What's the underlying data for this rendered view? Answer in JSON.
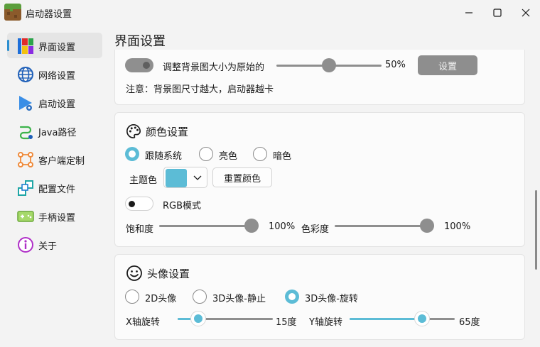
{
  "window": {
    "title": "启动器设置"
  },
  "sidebar": {
    "items": [
      {
        "label": "界面设置",
        "icon": "palette-grid-icon"
      },
      {
        "label": "网络设置",
        "icon": "globe-icon"
      },
      {
        "label": "启动设置",
        "icon": "play-icon"
      },
      {
        "label": "Java路径",
        "icon": "path-icon"
      },
      {
        "label": "客户端定制",
        "icon": "customize-icon"
      },
      {
        "label": "配置文件",
        "icon": "config-icon"
      },
      {
        "label": "手柄设置",
        "icon": "gamepad-icon"
      },
      {
        "label": "关于",
        "icon": "info-icon"
      }
    ],
    "active_index": 0
  },
  "page": {
    "title": "界面设置"
  },
  "background": {
    "resize_label": "调整背景图大小为原始的",
    "resize_value": 50,
    "resize_text": "50%",
    "set_button": "设置",
    "note": "注意：背景图尺寸越大，启动器越卡"
  },
  "color": {
    "title": "颜色设置",
    "modes": [
      "跟随系统",
      "亮色",
      "暗色"
    ],
    "selected_mode": 0,
    "theme_label": "主题色",
    "theme_color": "#5cbcd6",
    "reset_button": "重置颜色",
    "rgb_label": "RGB模式",
    "saturation_label": "饱和度",
    "saturation_value": 100,
    "saturation_text": "100%",
    "hue_label": "色彩度",
    "hue_value": 100,
    "hue_text": "100%"
  },
  "avatar": {
    "title": "头像设置",
    "modes": [
      "2D头像",
      "3D头像-静止",
      "3D头像-旋转"
    ],
    "selected_mode": 2,
    "x_label": "X轴旋转",
    "x_value": 15,
    "x_text": "15度",
    "y_label": "Y轴旋转",
    "y_value": 65,
    "y_text": "65度"
  },
  "colors": {
    "accent": "#5cbcd6",
    "selection_indicator": "#2d8fd0"
  }
}
